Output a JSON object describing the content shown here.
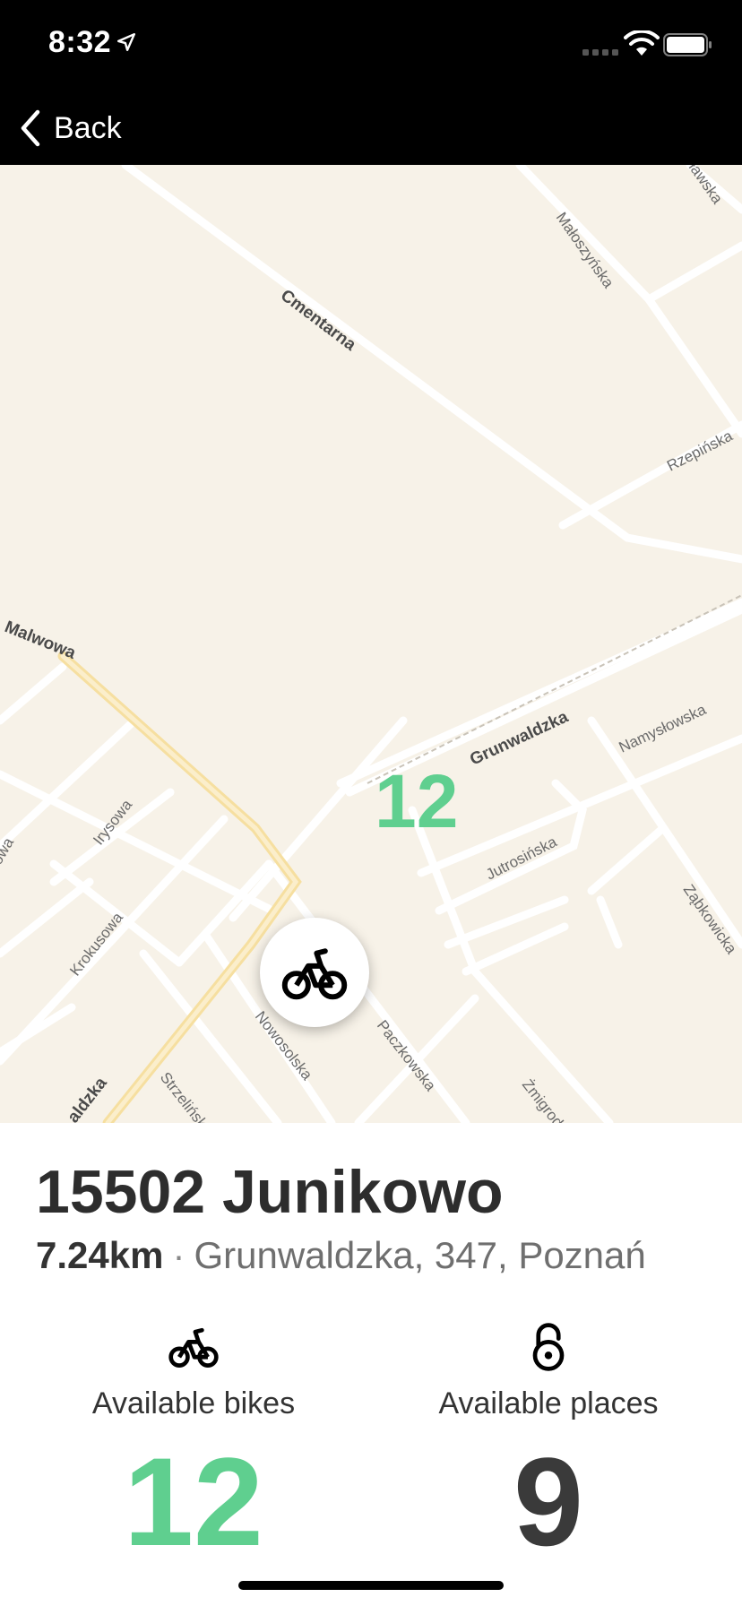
{
  "status_bar": {
    "time": "8:32",
    "icons": [
      "location-arrow-icon",
      "cellular-signal-icon",
      "wifi-icon",
      "battery-icon"
    ]
  },
  "nav": {
    "back_label": "Back",
    "back_icon": "chevron-left-icon"
  },
  "map": {
    "street_labels": {
      "cmentarna": "Cmentarna",
      "maloszynska": "Małoszyńska",
      "lawska": "ławska",
      "rzepinska": "Rzepińska",
      "malwowa": "Malwowa",
      "grunwaldzka": "Grunwaldzka",
      "namyslowska": "Namysłowska",
      "irysowa": "Irysowa",
      "owa": "owa",
      "jutrosinska": "Jutrosińska",
      "zabkowicka": "Ząbkowicka",
      "krokusowa": "Krokusowa",
      "nowosolska": "Nowosolska",
      "paczkowska": "Paczkowska",
      "zmigrodzka": "Żmigrodzka",
      "strzelinska": "Strzelińska",
      "aldzka": "aldzka"
    },
    "pin_icon": "bicycle-icon",
    "pin_count": "12"
  },
  "station": {
    "title": "15502 Junikowo",
    "distance": "7.24km",
    "separator": "·",
    "address": "Grunwaldzka, 347, Poznań"
  },
  "stats": {
    "bikes": {
      "icon": "bicycle-icon",
      "label": "Available bikes",
      "value": "12"
    },
    "places": {
      "icon": "unlocked-padlock-icon",
      "label": "Available places",
      "value": "9"
    }
  },
  "colors": {
    "accent_green": "#5fcf8f",
    "map_background": "#f7f2e8",
    "bars": "#000000"
  }
}
